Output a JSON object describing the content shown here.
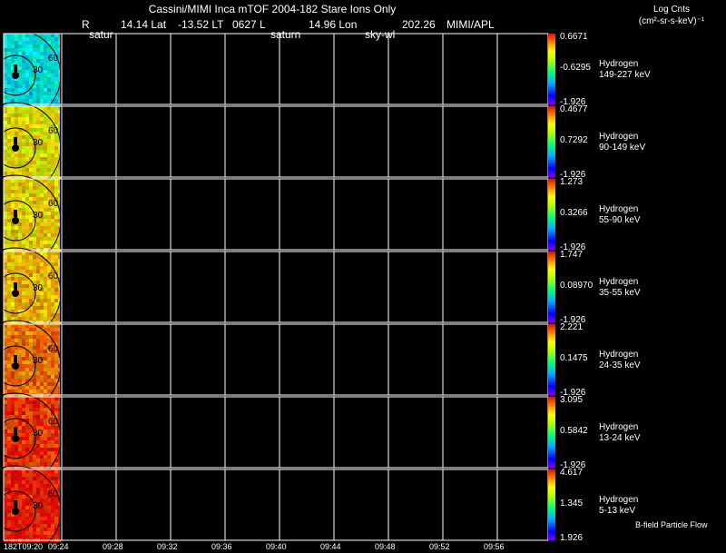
{
  "header": {
    "title": "Cassini/MIMI Inca mTOF  2004-182   Stare   Ions Only",
    "r_label": "R",
    "lat": "14.14 Lat",
    "lt": "-13.52 LT",
    "time_code": "0627 L",
    "lon": "14.96 Lon",
    "value": "202.26",
    "credit": "MIMI/APL",
    "sub_left": "satur",
    "sub_mid": "saturn",
    "sub_right": "sky-wl"
  },
  "colorbar_title": {
    "line1": "Log Cnts",
    "line2": "(cm²-sr-s-keV)⁻¹"
  },
  "footer_note": "B-field Particle Flow",
  "ring_labels": {
    "inner": "30",
    "outer": "60"
  },
  "chart_data": {
    "type": "heatmap",
    "x_ticks": [
      "182T09:20",
      "09:24",
      "09:28",
      "09:32",
      "09:36",
      "09:40",
      "09:44",
      "09:48",
      "09:52",
      "09:56"
    ],
    "panels": [
      {
        "species": "Hydrogen",
        "energy": "149-227 keV",
        "max": "0.6671",
        "mid": "-0.6295",
        "min": "-1.926",
        "base_hue": 180
      },
      {
        "species": "Hydrogen",
        "energy": "90-149 keV",
        "max": "0.4677",
        "mid": "0.7292",
        "min": "-1.926",
        "base_hue": 60
      },
      {
        "species": "Hydrogen",
        "energy": "55-90 keV",
        "max": "1.273",
        "mid": "0.3266",
        "min": "-1.926",
        "base_hue": 55
      },
      {
        "species": "Hydrogen",
        "energy": "35-55 keV",
        "max": "1.747",
        "mid": "0.08970",
        "min": "-1.926",
        "base_hue": 48
      },
      {
        "species": "Hydrogen",
        "energy": "24-35 keV",
        "max": "2.221",
        "mid": "0.1475",
        "min": "-1.926",
        "base_hue": 28
      },
      {
        "species": "Hydrogen",
        "energy": "13-24 keV",
        "max": "3.095",
        "mid": "0.5842",
        "min": "-1.926",
        "base_hue": 12
      },
      {
        "species": "Hydrogen",
        "energy": "5-13 keV",
        "max": "4.617",
        "mid": "1.345",
        "min": "1.926",
        "base_hue": 5
      }
    ]
  }
}
